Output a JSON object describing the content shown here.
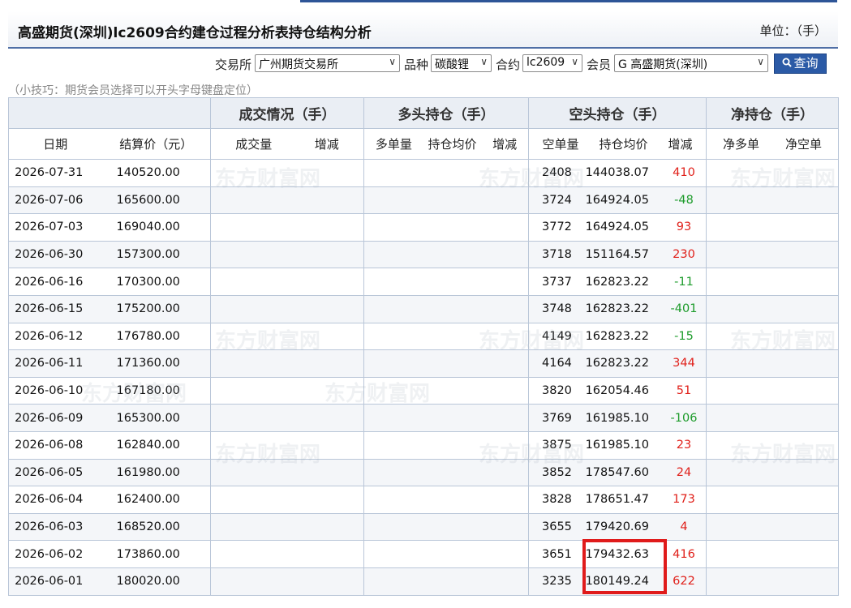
{
  "header": {
    "title": "高盛期货(深圳)lc2609合约建仓过程分析表持仓结构分析",
    "unit": "单位：（手）"
  },
  "filters": {
    "exchange_label": "交易所",
    "exchange_value": "广州期货交易所",
    "variety_label": "品种",
    "variety_value": "碳酸锂",
    "contract_label": "合约",
    "contract_value": "lc2609",
    "member_label": "会员",
    "member_value": "G 高盛期货(深圳)",
    "query_label": "查询",
    "chevron": "∨"
  },
  "tip": "（小技巧：期货会员选择可以开头字母键盘定位）",
  "watermark": "东方财富网",
  "table": {
    "groups": [
      "成交情况（手）",
      "多头持仓（手）",
      "空头持仓（手）",
      "净持仓（手）"
    ],
    "columns": {
      "date": "日期",
      "settle": "结算价（元）",
      "volume": "成交量",
      "volume_chg": "增减",
      "long_qty": "多单量",
      "long_avg": "持仓均价",
      "long_chg": "增减",
      "short_qty": "空单量",
      "short_avg": "持仓均价",
      "short_chg": "增减",
      "net_long": "净多单",
      "net_short": "净空单"
    },
    "rows": [
      {
        "date": "2026-07-31",
        "settle": "140520.00",
        "short_qty": "2408",
        "short_avg": "144038.07",
        "short_chg": "410"
      },
      {
        "date": "2026-07-06",
        "settle": "165600.00",
        "short_qty": "3724",
        "short_avg": "164924.05",
        "short_chg": "-48"
      },
      {
        "date": "2026-07-03",
        "settle": "169040.00",
        "short_qty": "3772",
        "short_avg": "164924.05",
        "short_chg": "93"
      },
      {
        "date": "2026-06-30",
        "settle": "157300.00",
        "short_qty": "3718",
        "short_avg": "151164.57",
        "short_chg": "230"
      },
      {
        "date": "2026-06-16",
        "settle": "170300.00",
        "short_qty": "3737",
        "short_avg": "162823.22",
        "short_chg": "-11"
      },
      {
        "date": "2026-06-15",
        "settle": "175200.00",
        "short_qty": "3748",
        "short_avg": "162823.22",
        "short_chg": "-401"
      },
      {
        "date": "2026-06-12",
        "settle": "176780.00",
        "short_qty": "4149",
        "short_avg": "162823.22",
        "short_chg": "-15"
      },
      {
        "date": "2026-06-11",
        "settle": "171360.00",
        "short_qty": "4164",
        "short_avg": "162823.22",
        "short_chg": "344"
      },
      {
        "date": "2026-06-10",
        "settle": "167180.00",
        "short_qty": "3820",
        "short_avg": "162054.46",
        "short_chg": "51"
      },
      {
        "date": "2026-06-09",
        "settle": "165300.00",
        "short_qty": "3769",
        "short_avg": "161985.10",
        "short_chg": "-106"
      },
      {
        "date": "2026-06-08",
        "settle": "162840.00",
        "short_qty": "3875",
        "short_avg": "161985.10",
        "short_chg": "23"
      },
      {
        "date": "2026-06-05",
        "settle": "161980.00",
        "short_qty": "3852",
        "short_avg": "178547.60",
        "short_chg": "24"
      },
      {
        "date": "2026-06-04",
        "settle": "162400.00",
        "short_qty": "3828",
        "short_avg": "178651.47",
        "short_chg": "173"
      },
      {
        "date": "2026-06-03",
        "settle": "168520.00",
        "short_qty": "3655",
        "short_avg": "179420.69",
        "short_chg": "4"
      },
      {
        "date": "2026-06-02",
        "settle": "173860.00",
        "short_qty": "3651",
        "short_avg": "179432.63",
        "short_chg": "416"
      },
      {
        "date": "2026-06-01",
        "settle": "180020.00",
        "short_qty": "3235",
        "short_avg": "180149.24",
        "short_chg": "622"
      }
    ]
  },
  "colors": {
    "increase": "#e0201a",
    "decrease": "#1c9b2a",
    "highlight": "#e01b1b",
    "accent": "#2b5aa6"
  }
}
